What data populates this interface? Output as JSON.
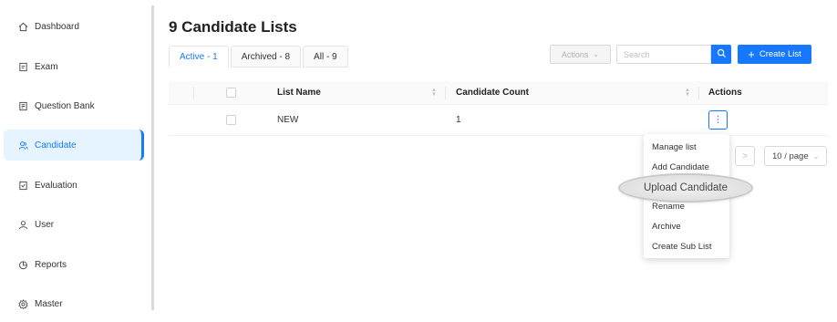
{
  "sidebar": {
    "items": [
      {
        "label": "Dashboard",
        "icon": "home-icon"
      },
      {
        "label": "Exam",
        "icon": "exam-icon"
      },
      {
        "label": "Question Bank",
        "icon": "question-bank-icon"
      },
      {
        "label": "Candidate",
        "icon": "candidate-icon",
        "active": true
      },
      {
        "label": "Evaluation",
        "icon": "evaluation-icon"
      },
      {
        "label": "User",
        "icon": "user-icon"
      },
      {
        "label": "Reports",
        "icon": "reports-icon"
      },
      {
        "label": "Master",
        "icon": "settings-icon"
      }
    ]
  },
  "main": {
    "title": "9 Candidate Lists",
    "tabs": [
      {
        "label": "Active - 1",
        "active": true
      },
      {
        "label": "Archived - 8"
      },
      {
        "label": "All - 9"
      }
    ]
  },
  "toolbar": {
    "actions_label": "Actions",
    "search_placeholder": "Search",
    "create_label": "Create List"
  },
  "table": {
    "columns": [
      "List Name",
      "Candidate Count",
      "Actions"
    ],
    "rows": [
      {
        "name": "NEW",
        "count": "1"
      }
    ]
  },
  "pagination": {
    "page_size": "10 / page"
  },
  "row_menu": {
    "items": [
      "Manage list",
      "Add Candidate",
      "Upload Candidate",
      "Rename",
      "Archive",
      "Create Sub List"
    ],
    "highlighted": "Upload Candidate"
  },
  "colors": {
    "accent": "#1677ff",
    "active_bg": "#e6f4ff"
  }
}
